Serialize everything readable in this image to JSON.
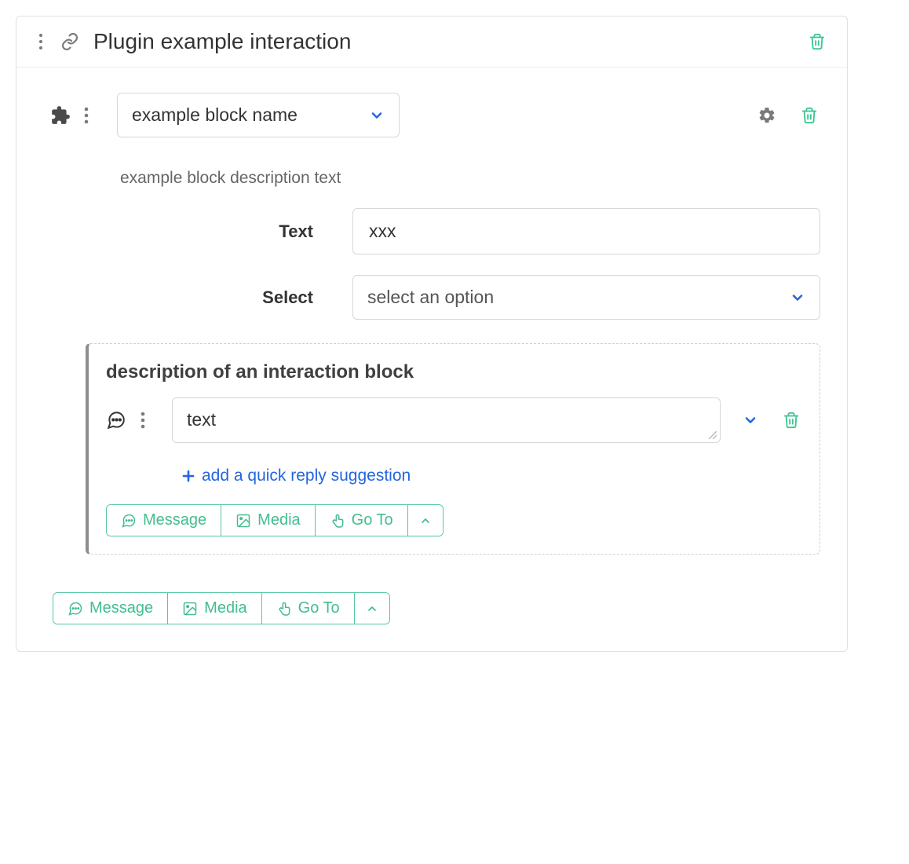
{
  "header": {
    "title": "Plugin example interaction"
  },
  "block": {
    "name": "example block name",
    "description": "example block description text",
    "fields": {
      "text": {
        "label": "Text",
        "value": "xxx"
      },
      "select": {
        "label": "Select",
        "placeholder": "select an option"
      }
    }
  },
  "inner": {
    "title": "description of an interaction block",
    "message": "text",
    "add_quick_reply": "add a quick reply suggestion",
    "toolbar": {
      "message": "Message",
      "media": "Media",
      "goto": "Go To"
    }
  },
  "toolbar": {
    "message": "Message",
    "media": "Media",
    "goto": "Go To"
  },
  "colors": {
    "teal": "#3cc492",
    "blue": "#2465e0",
    "grey": "#7a7a7a"
  }
}
